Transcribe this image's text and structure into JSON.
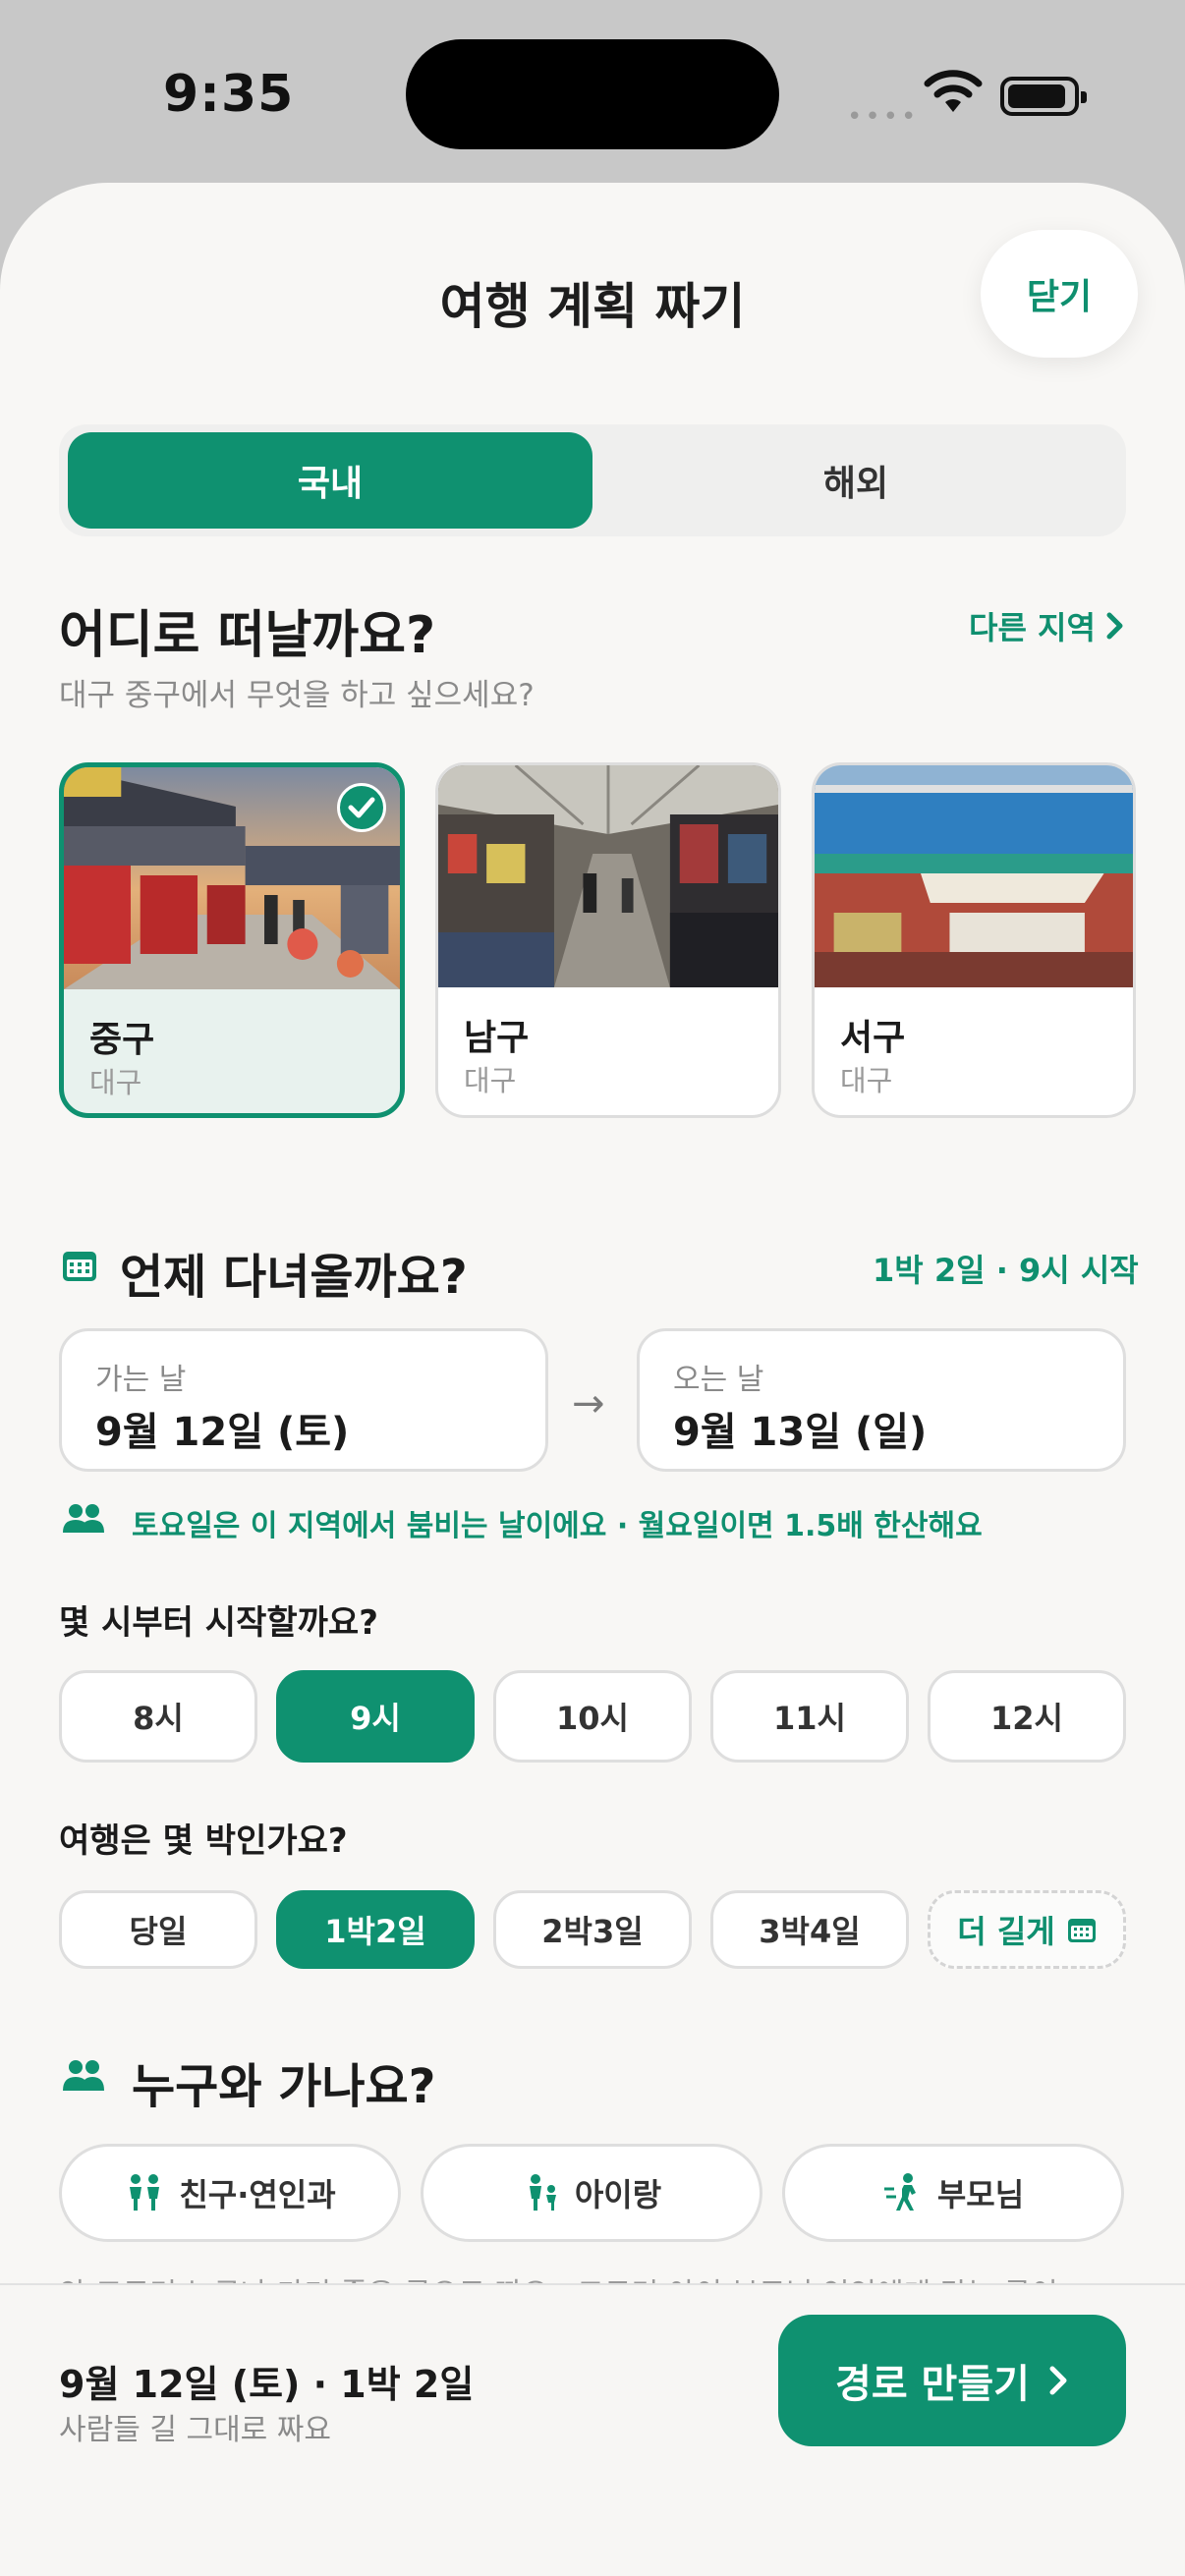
{
  "status": {
    "time": "9:35",
    "dots": "••••"
  },
  "sheet": {
    "title": "여행 계획 짜기",
    "close_label": "닫기"
  },
  "tabs": [
    {
      "label": "국내",
      "active": true
    },
    {
      "label": "해외",
      "active": false
    }
  ],
  "where": {
    "title": "어디로 떠날까요?",
    "other_region_label": "다른 지역",
    "subtitle": "대구 중구에서 무엇을 하고 싶으세요?",
    "cards": [
      {
        "name": "중구",
        "region": "대구",
        "selected": true
      },
      {
        "name": "남구",
        "region": "대구",
        "selected": false
      },
      {
        "name": "서구",
        "region": "대구",
        "selected": false
      }
    ]
  },
  "when": {
    "title": "언제 다녀올까요?",
    "summary": "1박 2일 · 9시 시작",
    "depart_label": "가는 날",
    "depart_value": "9월 12일 (토)",
    "return_label": "오는 날",
    "return_value": "9월 13일 (일)",
    "arrow": "→",
    "hint": "토요일은 이 지역에서 붐비는 날이에요 · 월요일이면 1.5배 한산해요"
  },
  "start_time": {
    "question": "몇 시부터 시작할까요?",
    "options": [
      "8시",
      "9시",
      "10시",
      "11시",
      "12시"
    ],
    "selected": "9시"
  },
  "nights": {
    "question": "여행은 몇 박인가요?",
    "options": [
      "당일",
      "1박2일",
      "2박3일",
      "3박4일"
    ],
    "selected": "1박2일",
    "more_label": "더 길게"
  },
  "who": {
    "title": "누구와 가나요?",
    "options": [
      "친구·연인과",
      "아이랑",
      "부모님"
    ],
    "cut_text": "안 고르면 누구나 가기 좋은 곳으로 짜요 · 고르면 아이·부모님·연인에게 맞는 곳이"
  },
  "footer": {
    "summary": "9월 12일 (토) · 1박 2일",
    "subtext": "사람들 길 그대로 짜요",
    "cta_label": "경로 만들기"
  },
  "colors": {
    "accent": "#0f9170",
    "background": "#f8f7f5"
  }
}
